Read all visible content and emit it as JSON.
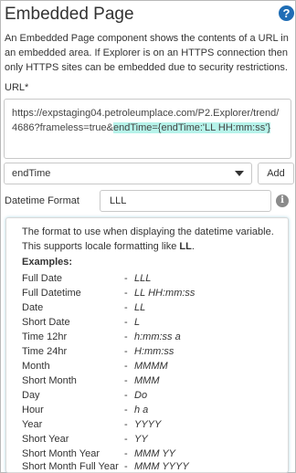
{
  "title": "Embedded Page",
  "description": "An Embedded Page component shows the contents of a URL in an embedded area. If Explorer is on an HTTPS connection then only HTTPS sites can be embedded due to security restrictions.",
  "url": {
    "label": "URL*",
    "value_plain": "https://expstaging04.petroleumplace.com/P2.Explorer/trend/4686?frameless=true&",
    "value_highlighted": "endTime={endTime:'LL HH:mm:ss'}"
  },
  "variable_select": {
    "selected": "endTime",
    "add_label": "Add"
  },
  "datetime_format": {
    "label": "Datetime Format",
    "value": "LLL"
  },
  "tooltip": {
    "text_before": "The format to use when displaying the datetime variable. This supports locale formatting like ",
    "text_bold": "LL",
    "text_after": ".",
    "examples_label": "Examples:",
    "dash": "-",
    "examples": [
      {
        "name": "Full Date",
        "format": "LLL"
      },
      {
        "name": "Full Datetime",
        "format": "LL HH:mm:ss"
      },
      {
        "name": "Date",
        "format": "LL"
      },
      {
        "name": "Short Date",
        "format": "L"
      },
      {
        "name": "Time 12hr",
        "format": "h:mm:ss a"
      },
      {
        "name": "Time 24hr",
        "format": "H:mm:ss"
      },
      {
        "name": "Month",
        "format": "MMMM"
      },
      {
        "name": "Short Month",
        "format": "MMM"
      },
      {
        "name": "Day",
        "format": "Do"
      },
      {
        "name": "Hour",
        "format": "h a"
      },
      {
        "name": "Year",
        "format": "YYYY"
      },
      {
        "name": "Short Year",
        "format": "YY"
      },
      {
        "name": "Short Month Year",
        "format": "MMM YY"
      },
      {
        "name": "Short Month Full Year",
        "format": "MMM YYYY"
      }
    ]
  },
  "icons": {
    "help": "?",
    "info": "i"
  },
  "colors": {
    "accent": "#1f6db5",
    "highlight": "#b6f3ea"
  }
}
